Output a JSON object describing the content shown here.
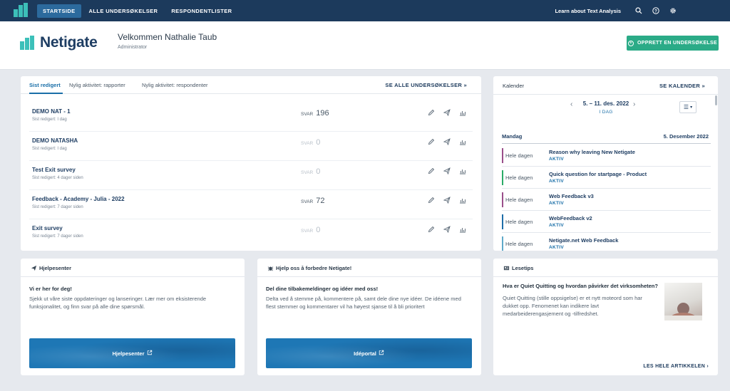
{
  "nav": {
    "tabs": [
      "STARTSIDE",
      "ALLE UNDERSØKELSER",
      "RESPONDENTLISTER"
    ],
    "learn_link": "Learn about Text Analysis",
    "icons": [
      "search-icon",
      "help-icon",
      "settings-icon"
    ]
  },
  "header": {
    "brand": "Netigate",
    "welcome": "Velkommen Nathalie Taub",
    "role": "Administrator",
    "create_button": "OPPRETT EN UNDERSØKELSE"
  },
  "surveys": {
    "tabs": [
      "Sist redigert",
      "Nylig aktivitet: rapporter",
      "Nylig aktivitet: respondenter"
    ],
    "see_all": "SE ALLE UNDERSØKELSER",
    "svar_label": "SVAR",
    "rows": [
      {
        "name": "DEMO NAT - 1",
        "edited": "Sist redigert: I dag",
        "responses": "196"
      },
      {
        "name": "DEMO NATASHA",
        "edited": "Sist redigert: I dag",
        "responses": "0"
      },
      {
        "name": "Test Exit survey",
        "edited": "Sist redigert: 4 dager siden",
        "responses": "0"
      },
      {
        "name": "Feedback - Academy - Julia - 2022",
        "edited": "Sist redigert: 7 dager siden",
        "responses": "72"
      },
      {
        "name": "Exit survey",
        "edited": "Sist redigert: 7 dager siden",
        "responses": "0"
      }
    ]
  },
  "calendar": {
    "title": "Kalender",
    "see_calendar": "SE KALENDER",
    "range": "5. – 11. des. 2022",
    "today": "I DAG",
    "day": "Mandag",
    "date": "5. Desember 2022",
    "events": [
      {
        "when": "Hele dagen",
        "title": "Reason why leaving New Netigate",
        "status": "AKTIV",
        "color": "#9a4f8a"
      },
      {
        "when": "Hele dagen",
        "title": "Quick question for startpage - Product",
        "status": "AKTIV",
        "color": "#2bab67"
      },
      {
        "when": "Hele dagen",
        "title": "Web Feedback v3",
        "status": "AKTIV",
        "color": "#9a4f8a"
      },
      {
        "when": "Hele dagen",
        "title": "WebFeedback v2",
        "status": "AKTIV",
        "color": "#1e6ea8"
      },
      {
        "when": "Hele dagen",
        "title": "Netigate.net Web Feedback",
        "status": "AKTIV",
        "color": "#5fa9c9"
      }
    ]
  },
  "help": {
    "title": "Hjelpesenter",
    "lead": "Vi er her for deg!",
    "body_1": "Sjekk ut våre siste oppdateringer og lanseringer. Lær mer om eksisterende",
    "body_2": "funksjonalitet, og finn svar på alle dine spørsmål.",
    "button": "Hjelpesenter"
  },
  "ideas": {
    "title": "Hjelp oss å forbedre Netigate!",
    "lead": "Del dine tilbakemeldinger og idéer med oss!",
    "body_1": "Delta ved å stemme på, kommentere på, samt dele dine nye idéer. De idéene med",
    "body_2": "flest stemmer og kommentarer vil ha høyest sjanse til å bli prioritert",
    "button": "Idéportal"
  },
  "reading": {
    "title": "Lesetips",
    "question": "Hva er Quiet Quitting og hvordan påvirker det virksomheten?",
    "body_1": "Quiet Quitting (stille oppsigelse) er et nytt moteord som har",
    "body_2": "dukket opp. Fenomenet kan indikere lavt",
    "body_3": "medarbeiderengasjement og -tilfredshet.",
    "read_more": "LES HELE ARTIKKELEN"
  }
}
